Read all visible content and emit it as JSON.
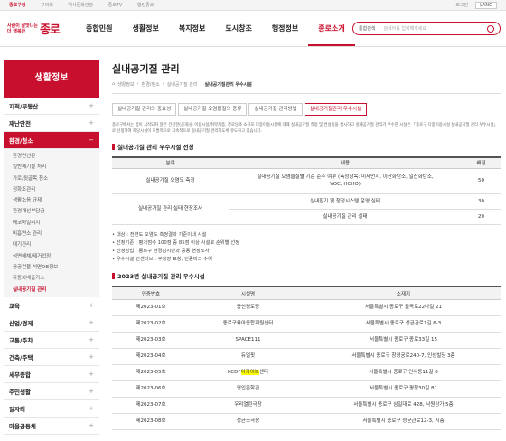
{
  "topbar": {
    "links": [
      "종로구청",
      "구의회",
      "역사문화관광",
      "종로TV",
      "열린종로"
    ],
    "login": "로그인",
    "lang": "LANG"
  },
  "logo": {
    "line1": "사람이 살맛나는",
    "line2": "더 행복한",
    "brand": "종로"
  },
  "gnb": [
    "종합민원",
    "생활정보",
    "복지정보",
    "도시창조",
    "행정정보",
    "종로소개"
  ],
  "search": {
    "select": "통합검색",
    "placeholder": "검색어를 입력해주세요"
  },
  "lnb": {
    "title": "생활정보",
    "items_before": [
      "지적/부동산",
      "재난안전"
    ],
    "active": "환경/청소",
    "sub": [
      "환경연선문",
      "일반폐기물 처리",
      "가로/뒷골목 청소",
      "정화조관리",
      "생활소음 규제",
      "환경개선부담금",
      "에코마일리지",
      "비흡연소 관리",
      "대기관리",
      "석면해체/제거업장",
      "공공건물 석면DB정보",
      "자동차배출가스",
      "실내공기질 관리"
    ],
    "items_after": [
      "교육",
      "산업/경제",
      "교통/주차",
      "건축/주택",
      "세무종합",
      "주민생활",
      "일자리",
      "마을공동체"
    ]
  },
  "page": {
    "title": "실내공기질 관리",
    "breadcrumb": [
      "생활정보",
      "환경/청소",
      "실내공기질 관리",
      "실내공기질관리 우수시설"
    ],
    "tabs": [
      "실내공기질 관리의 중요성",
      "실내공기질 오염물질의 종류",
      "실내공기질 관리방법",
      "실내공기질관리 우수시설"
    ],
    "intro": "종로구에서는 법이 시작되지 않은 건강한(공개)을 이용시설/취약계층, 경로당과 소규모 다중이용시설에 대해 실내공기질 측정 및 컨설팅을 실시하고 실내공기질 관리가 우수한 시설은 「종로구 다중이용시설 실내공기질 관리 우수시설」로 선정하여 해당시설이 자발적으로 지속적으로 실내공기질 관리하도록 유도하고 있습니다."
  },
  "criteria": {
    "heading": "실내공기질 관리 우수시설 선정",
    "columns": [
      "분야",
      "내용",
      "배점"
    ],
    "rows": [
      {
        "field": "실내공기질 오염도 측정",
        "content": "실내공기질 오염물질별 기준 준수 여부 (측정항목: 미세먼지, 이산화탄소, 일산화탄소, VOC, HCHO)",
        "score": "50"
      },
      {
        "field": "실내공기질 관리 실태 현장조사",
        "content": "실내환기 및 청정시스템 운영 실태",
        "score": "30"
      },
      {
        "field": "",
        "content": "실내공기질 관리 실태",
        "score": "20"
      }
    ]
  },
  "notes": [
    "대상 : 전년도 오염도 측정결과 기준이내 시설",
    "선정기준 : 평가점수 100점 중 85점 이상 시설로 순위별 선정",
    "선정방법 : 종로구 환경감시단과 공동 현장조사",
    "우수시설 인센티브 : 구청장 표창, 인증마크 수여"
  ],
  "list": {
    "heading": "2023년 실내공기질 관리 우수시설",
    "columns": [
      "인증번호",
      "시설명",
      "소재지"
    ],
    "rows": [
      {
        "no": "제2023-01호",
        "name": "충신경로당",
        "addr": "서울특별시 종로구 율곡로22나길 21"
      },
      {
        "no": "제2023-02호",
        "name": "종로구육아종합지원센터",
        "addr": "서울특별시 종로구 성균관로1길 6-3"
      },
      {
        "no": "제2023-03호",
        "name": "SPACE111",
        "addr": "서울특별시 종로구 종로33길 15"
      },
      {
        "no": "제2023-04호",
        "name": "듀얼핏",
        "addr": "서울특별시 종로구 창경궁로240-7, 인성빌딩 3층"
      },
      {
        "no": "제2023-05호",
        "name_a": "KCDF",
        "name_hl": "아카이브",
        "name_b": "센터",
        "addr": "서울특별시 종로구 인사동11길 8"
      },
      {
        "no": "제2023-06호",
        "name": "영인문학관",
        "addr": "서울특별시 종로구 평창30길 81"
      },
      {
        "no": "제2023-07호",
        "name": "우리열린극장",
        "addr": "서울특별시 종로구 삼일대로 428, 낙원상가 5층"
      },
      {
        "no": "제2023-08호",
        "name": "성균소극장",
        "addr": "서울특별시 종로구 성균관로12-3, 지층"
      }
    ]
  },
  "colors": {
    "accent": "#c8102e"
  }
}
